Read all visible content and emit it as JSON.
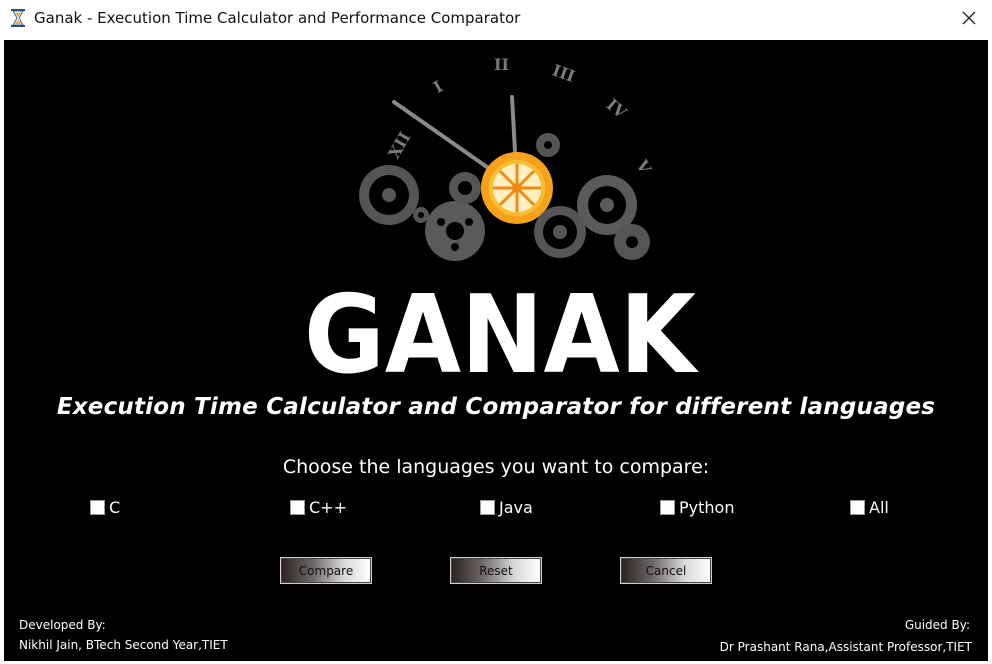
{
  "window": {
    "title": "Ganak - Execution Time Calculator and Performance Comparator"
  },
  "logo": {
    "text": "GANAK"
  },
  "clock": {
    "numerals": [
      "XII",
      "I",
      "II",
      "III",
      "IV",
      "V"
    ]
  },
  "subtitle": "Execution Time Calculator and Comparator for different languages",
  "prompt": "Choose the languages you want to compare:",
  "languages": [
    {
      "label": "C",
      "checked": false
    },
    {
      "label": "C++",
      "checked": false
    },
    {
      "label": "Java",
      "checked": false
    },
    {
      "label": "Python",
      "checked": false
    },
    {
      "label": "All",
      "checked": false
    }
  ],
  "buttons": {
    "compare": "Compare",
    "reset": "Reset",
    "cancel": "Cancel"
  },
  "footer": {
    "developed_heading": "Developed By:",
    "developer": "Nikhil Jain, BTech Second Year,TIET",
    "guided_heading": "Guided By:",
    "guide": "Dr Prashant Rana,Assistant Professor,TIET"
  },
  "colors": {
    "background": "#000000",
    "accent_gear": "#f7a21b",
    "gears": "#5a5a5a",
    "text": "#ffffff"
  },
  "icons": {
    "app": "hourglass-icon",
    "close": "close-icon"
  }
}
